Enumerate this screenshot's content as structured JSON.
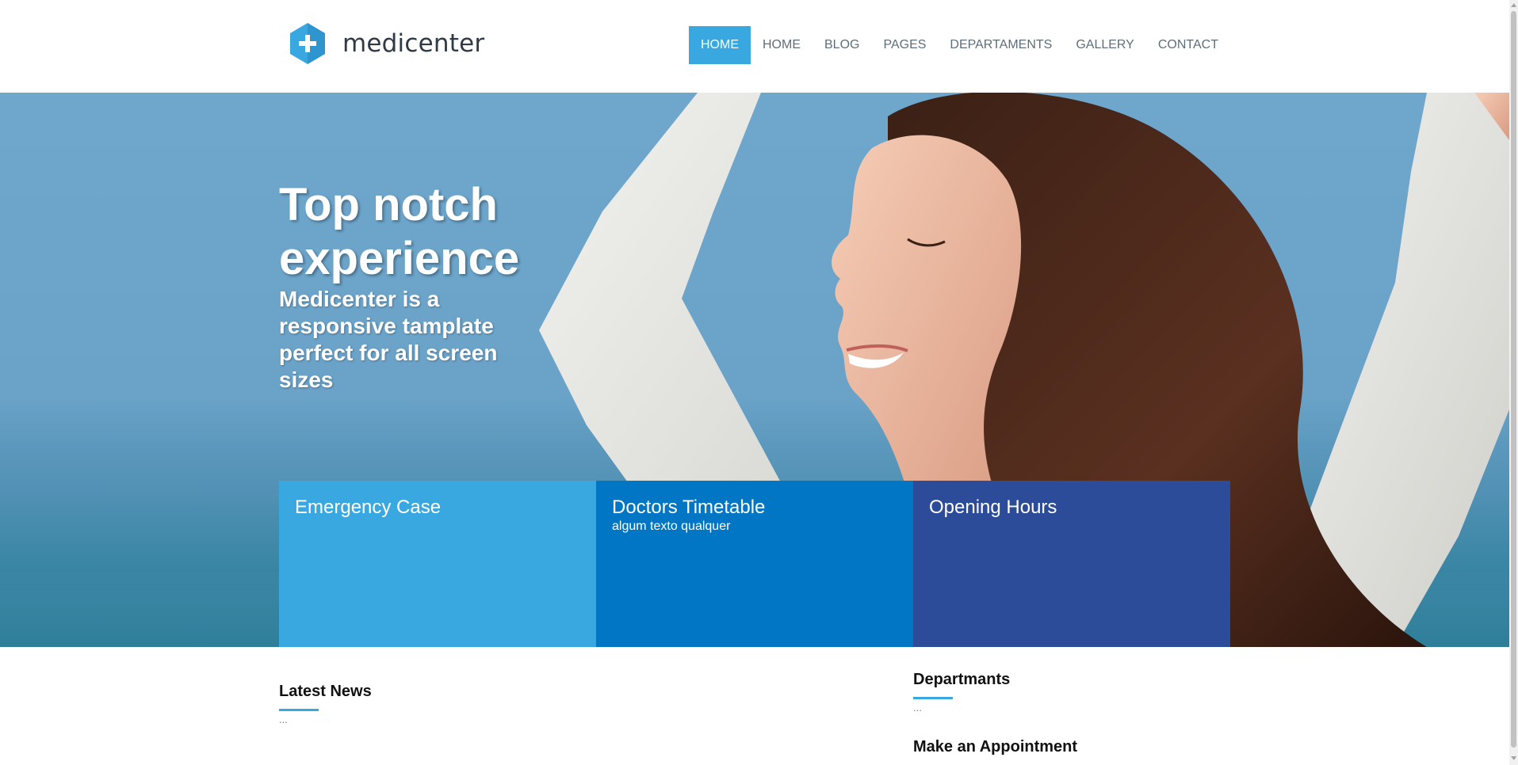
{
  "header": {
    "logo_text": "medicenter",
    "logo_icon": "hexagon-plus-icon",
    "nav": [
      {
        "label": "HOME",
        "active": true
      },
      {
        "label": "HOME",
        "active": false
      },
      {
        "label": "BLOG",
        "active": false
      },
      {
        "label": "PAGES",
        "active": false
      },
      {
        "label": "DEPARTAMENTS",
        "active": false
      },
      {
        "label": "GALLERY",
        "active": false
      },
      {
        "label": "CONTACT",
        "active": false
      }
    ]
  },
  "hero": {
    "title": "Top notch experience",
    "subtitle": "Medicenter is a responsive tamplate perfect for all screen sizes"
  },
  "boxes": [
    {
      "title": "Emergency Case",
      "text": "",
      "color": "#3aa8e0"
    },
    {
      "title": "Doctors Timetable",
      "text": "algum texto qualquer",
      "color": "#0076c4"
    },
    {
      "title": "Opening Hours",
      "text": "",
      "color": "#2c4c99"
    }
  ],
  "content": {
    "latest_news": {
      "title": "Latest News",
      "body": "..."
    },
    "departments": {
      "title": "Departmants",
      "body": "..."
    },
    "appointment": {
      "title": "Make an Appointment"
    }
  },
  "colors": {
    "accent": "#3aa8e0",
    "box_mid": "#0076c4",
    "box_dark": "#2c4c99"
  }
}
